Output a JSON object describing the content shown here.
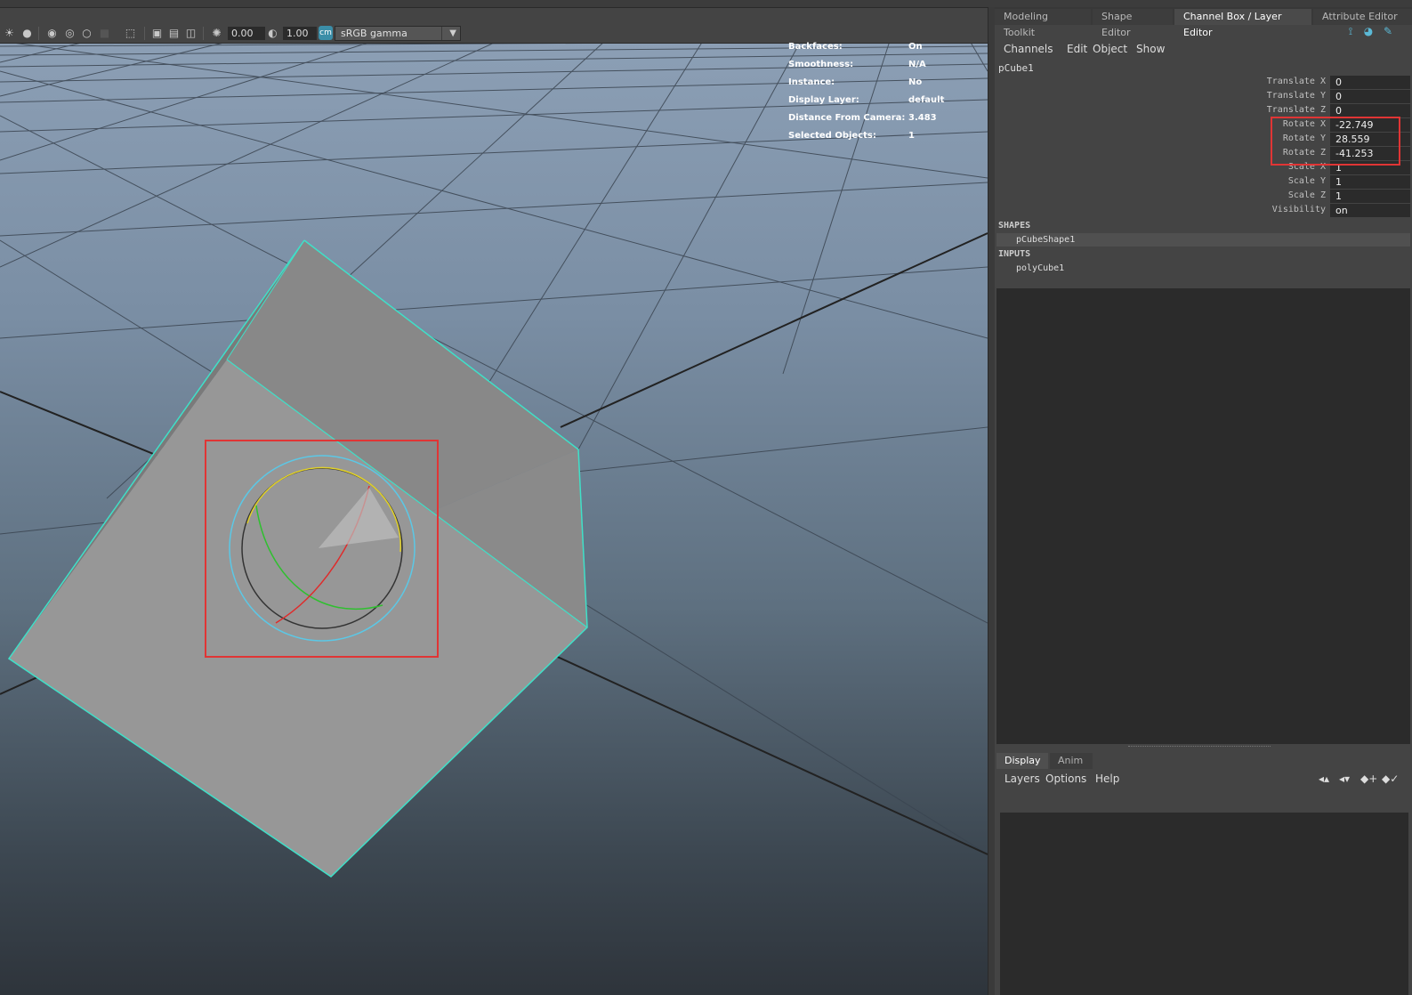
{
  "viewport": {
    "toolbar": {
      "exposure_value": "0.00",
      "gamma_value": "1.00",
      "color_space": "sRGB gamma"
    },
    "hud": [
      {
        "key": "Backfaces:",
        "value": "On"
      },
      {
        "key": "Smoothness:",
        "value": "N/A"
      },
      {
        "key": "Instance:",
        "value": "No"
      },
      {
        "key": "Display Layer:",
        "value": "default"
      },
      {
        "key": "Distance From Camera:",
        "value": "3.483"
      },
      {
        "key": "Selected Objects:",
        "value": "1"
      }
    ],
    "colors": {
      "selection_wire": "#3fe0c8",
      "highlight_box": "#e03535",
      "rotate_x_ring": "#e02a2a",
      "rotate_y_ring": "#2fc02f",
      "rotate_z_ring": "#e0d02a",
      "view_ring": "#5bc8e6"
    }
  },
  "panel": {
    "tabs": [
      {
        "label": "Modeling Toolkit",
        "active": false
      },
      {
        "label": "Shape Editor",
        "active": false
      },
      {
        "label": "Channel Box / Layer Editor",
        "active": true
      },
      {
        "label": "Attribute Editor",
        "active": false
      }
    ],
    "menu": [
      "Channels",
      "Edit",
      "Object",
      "Show"
    ],
    "object_name": "pCube1",
    "channels": [
      {
        "label": "Translate X",
        "value": "0"
      },
      {
        "label": "Translate Y",
        "value": "0"
      },
      {
        "label": "Translate Z",
        "value": "0"
      },
      {
        "label": "Rotate X",
        "value": "-22.749"
      },
      {
        "label": "Rotate Y",
        "value": "28.559"
      },
      {
        "label": "Rotate Z",
        "value": "-41.253"
      },
      {
        "label": "Scale X",
        "value": "1"
      },
      {
        "label": "Scale Y",
        "value": "1"
      },
      {
        "label": "Scale Z",
        "value": "1"
      },
      {
        "label": "Visibility",
        "value": "on"
      }
    ],
    "shapes_title": "SHAPES",
    "shape_item": "pCubeShape1",
    "inputs_title": "INPUTS",
    "input_item": "polyCube1",
    "layer_tabs": [
      {
        "label": "Display",
        "active": true
      },
      {
        "label": "Anim",
        "active": false
      }
    ],
    "layer_menu": [
      "Layers",
      "Options",
      "Help"
    ]
  }
}
